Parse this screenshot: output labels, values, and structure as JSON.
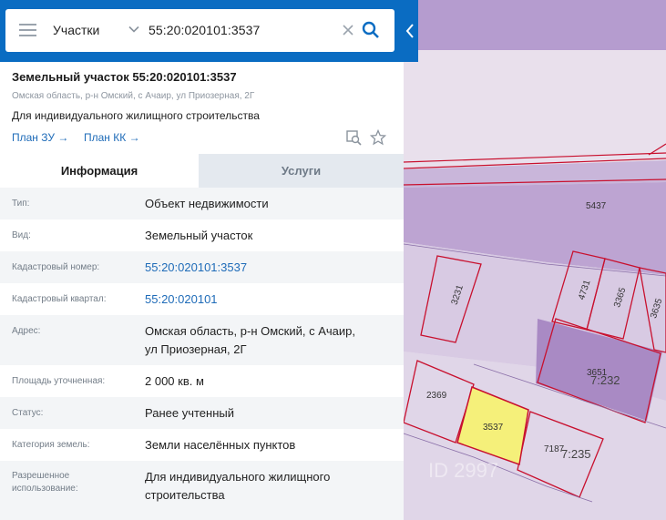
{
  "search": {
    "type_label": "Участки",
    "query": "55:20:020101:3537"
  },
  "parcel": {
    "title": "Земельный участок 55:20:020101:3537",
    "address_short": "Омская область, р-н Омский, с Ачаир, ул Приозерная, 2Г",
    "purpose": "Для индивидуального жилищного строительства",
    "plan_zu": "План ЗУ →",
    "plan_kk": "План КК →"
  },
  "tabs": {
    "info": "Информация",
    "services": "Услуги"
  },
  "rows": [
    {
      "key": "Тип:",
      "value": "Объект недвижимости"
    },
    {
      "key": "Вид:",
      "value": "Земельный участок"
    },
    {
      "key": "Кадастровый номер:",
      "value": "55:20:020101:3537"
    },
    {
      "key": "Кадастровый квартал:",
      "value": "55:20:020101"
    },
    {
      "key": "Адрес:",
      "value": "Омская область, р-н Омский, с Ачаир,",
      "value2": "ул Приозерная, 2Г"
    },
    {
      "key": "Площадь уточненная:",
      "value": "2 000 кв. м"
    },
    {
      "key": "Статус:",
      "value": "Ранее учтенный"
    },
    {
      "key": "Категория земель:",
      "value": "Земли населённых пунктов"
    },
    {
      "key": "Разрешенное",
      "key2": "использование:",
      "value": "Для индивидуального жилищного",
      "value2": "строительства"
    }
  ],
  "map": {
    "labels": [
      "5437",
      "3231",
      "4731",
      "3365",
      "3635",
      "3651",
      "7:232",
      "2369",
      "3537",
      "7187",
      "7:235"
    ],
    "watermark": "ID 2997"
  },
  "colors": {
    "header": "#0a6cc2",
    "link": "#1e6bb8",
    "selected_parcel": "#f5f07a",
    "parcel_outline": "#c8102e"
  }
}
